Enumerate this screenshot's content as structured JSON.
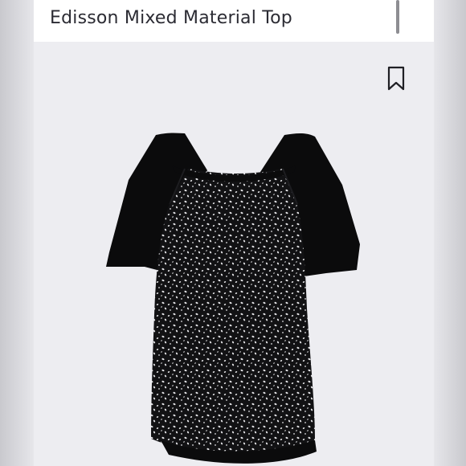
{
  "product": {
    "title": "Edisson Mixed Material Top",
    "image_alt": "",
    "bookmark_icon": "bookmark-icon"
  },
  "colors": {
    "background": "#ebebef",
    "garment_solid": "#0b0b0c",
    "garment_print": "#121214",
    "print_dots": "#e9e9ec"
  }
}
